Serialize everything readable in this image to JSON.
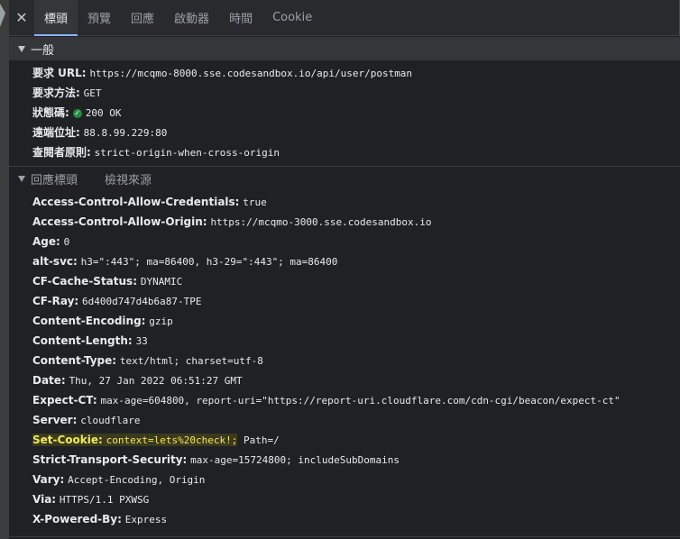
{
  "tabs": [
    "標頭",
    "預覽",
    "回應",
    "啟動器",
    "時間",
    "Cookie"
  ],
  "close_glyph": "✕",
  "general": {
    "title": "一般",
    "rows": [
      {
        "key": "要求 URL:",
        "value": "https://mcqmo-8000.sse.codesandbox.io/api/user/postman"
      },
      {
        "key": "要求方法:",
        "value": "GET"
      },
      {
        "key": "狀態碼:",
        "value": "200 OK"
      },
      {
        "key": "遠端位址:",
        "value": "88.8.99.229:80"
      },
      {
        "key": "查閱者原則:",
        "value": "strict-origin-when-cross-origin"
      }
    ]
  },
  "response_headers": {
    "title": "回應標頭",
    "view_source": "檢視來源",
    "rows": [
      {
        "key": "Access-Control-Allow-Credentials:",
        "value": "true"
      },
      {
        "key": "Access-Control-Allow-Origin:",
        "value": "https://mcqmo-3000.sse.codesandbox.io"
      },
      {
        "key": "Age:",
        "value": "0"
      },
      {
        "key": "alt-svc:",
        "value": "h3=\":443\"; ma=86400, h3-29=\":443\"; ma=86400"
      },
      {
        "key": "CF-Cache-Status:",
        "value": "DYNAMIC"
      },
      {
        "key": "CF-Ray:",
        "value": "6d400d747d4b6a87-TPE"
      },
      {
        "key": "Content-Encoding:",
        "value": "gzip"
      },
      {
        "key": "Content-Length:",
        "value": "33"
      },
      {
        "key": "Content-Type:",
        "value": "text/html; charset=utf-8"
      },
      {
        "key": "Date:",
        "value": "Thu, 27 Jan 2022 06:51:27 GMT"
      },
      {
        "key": "Expect-CT:",
        "value": "max-age=604800, report-uri=\"https://report-uri.cloudflare.com/cdn-cgi/beacon/expect-ct\""
      },
      {
        "key": "Server:",
        "value": "cloudflare"
      },
      {
        "key": "Set-Cookie:",
        "value": "context=lets%20check!;",
        "value2": " Path=/"
      },
      {
        "key": "Strict-Transport-Security:",
        "value": "max-age=15724800; includeSubDomains"
      },
      {
        "key": "Vary:",
        "value": "Accept-Encoding, Origin"
      },
      {
        "key": "Via:",
        "value": "HTTPS/1.1 PXWSG"
      },
      {
        "key": "X-Powered-By:",
        "value": "Express"
      }
    ]
  },
  "colors": {
    "background": "#202124",
    "accent": "#8ab4f8",
    "highlight": "#f5e85a",
    "status_ok": "#1e8e3e"
  }
}
